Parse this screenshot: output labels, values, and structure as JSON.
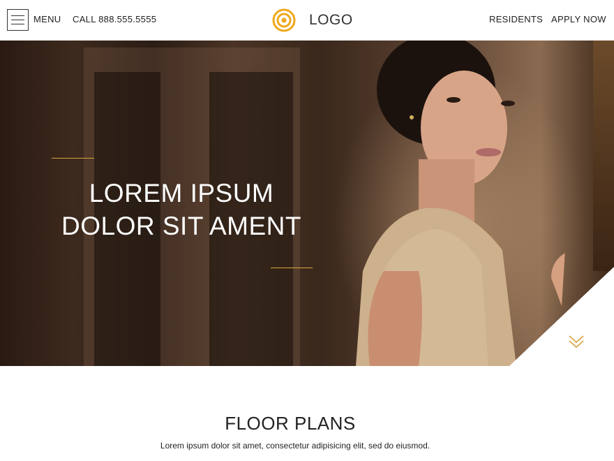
{
  "header": {
    "menu_label": "MENU",
    "call_label": "CALL 888.555.5555",
    "logo_text": "LOGO",
    "residents_label": "RESIDENTS",
    "apply_label": "APPLY NOW"
  },
  "hero": {
    "title_line1": "LOREM IPSUM",
    "title_line2": "DOLOR SIT AMENT"
  },
  "floor_plans": {
    "title": "FLOOR PLANS",
    "description": "Lorem ipsum dolor sit amet, consectetur adipisicing elit, sed do eiusmod."
  },
  "colors": {
    "accent": "#d9a441",
    "logo": "#f0a81c"
  },
  "icons": {
    "menu": "hamburger-icon",
    "logo": "concentric-circles-logo",
    "scroll": "double-chevron-down-icon"
  }
}
